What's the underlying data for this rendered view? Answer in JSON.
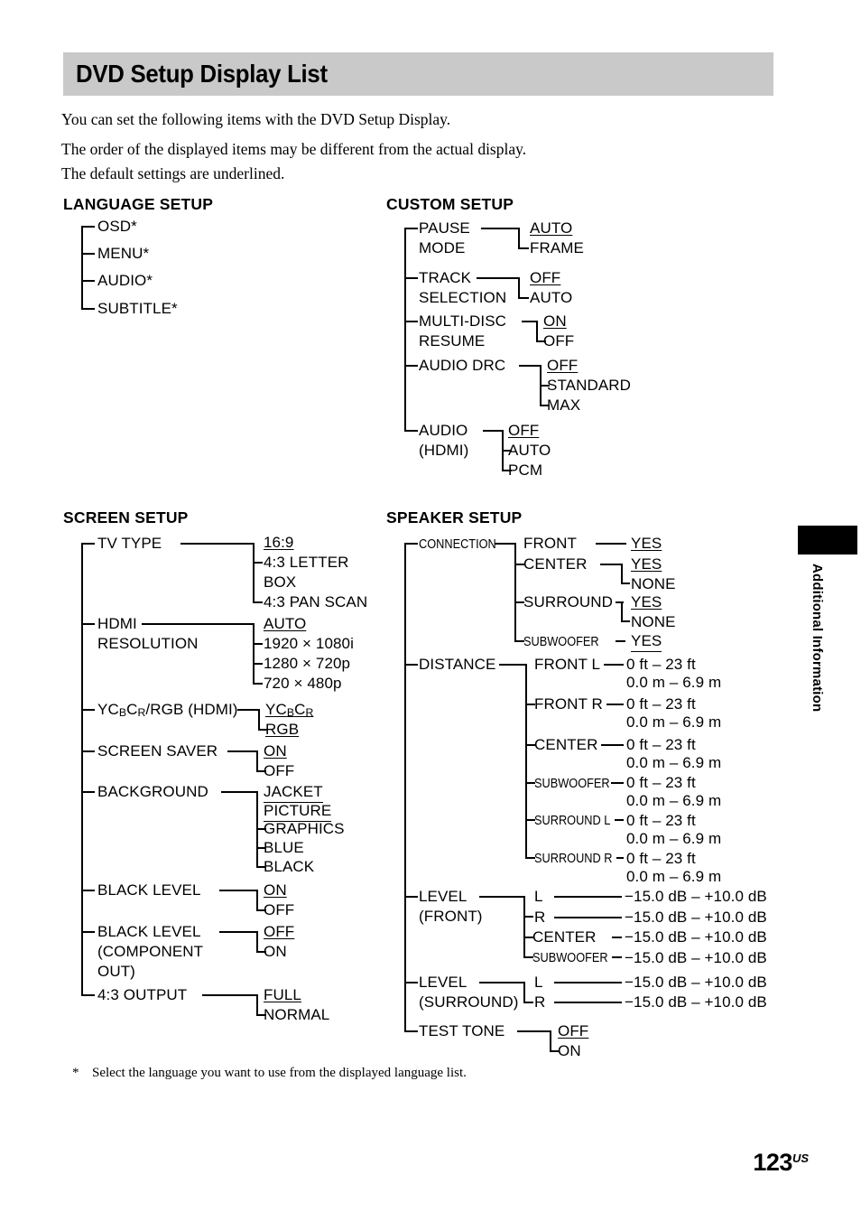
{
  "page": {
    "title": "DVD Setup Display List",
    "intro_line_1": "You can set the following items with the DVD Setup Display.",
    "intro_line_2a": "The order of the displayed items may be different from the actual display.",
    "intro_line_2b": "The default settings are underlined.",
    "footnote_marker": "*",
    "footnote_text": "Select the language you want to use from the displayed language list.",
    "page_number": "123",
    "page_number_suffix": "US",
    "side_tab_label": "Additional Information",
    "header_bg": "#c9c9c9"
  },
  "language_setup": {
    "title": "LANGUAGE SETUP",
    "items": [
      {
        "label": "OSD*"
      },
      {
        "label": "MENU*"
      },
      {
        "label": "AUDIO*"
      },
      {
        "label": "SUBTITLE*"
      }
    ]
  },
  "custom_setup": {
    "title": "CUSTOM SETUP",
    "items": [
      {
        "label_1": "PAUSE",
        "label_2": "MODE",
        "options": [
          "AUTO",
          "FRAME"
        ],
        "default": "AUTO"
      },
      {
        "label_1": "TRACK",
        "label_2": "SELECTION",
        "options": [
          "OFF",
          "AUTO"
        ],
        "default": "OFF"
      },
      {
        "label_1": "MULTI-DISC",
        "label_2": "RESUME",
        "options": [
          "ON",
          "OFF"
        ],
        "default": "ON"
      },
      {
        "label_1": "AUDIO DRC",
        "label_2": "",
        "options": [
          "OFF",
          "STANDARD",
          "MAX"
        ],
        "default": "OFF"
      },
      {
        "label_1": "AUDIO",
        "label_2": "(HDMI)",
        "options": [
          "OFF",
          "AUTO",
          "PCM"
        ],
        "default": "OFF"
      }
    ]
  },
  "screen_setup": {
    "title": "SCREEN SETUP",
    "items": [
      {
        "label_1": "TV TYPE",
        "options": [
          "16:9",
          "4:3 LETTER",
          "BOX",
          "4:3 PAN SCAN"
        ],
        "default": "16:9"
      },
      {
        "label_1": "HDMI",
        "label_2": "RESOLUTION",
        "options": [
          "AUTO",
          "1920 × 1080i",
          "1280 × 720p",
          "720 × 480p"
        ],
        "default": "AUTO"
      },
      {
        "label_1": "YCʙCʀ/RGB (HDMI)",
        "options": [
          "YCʙCʀ",
          "RGB"
        ],
        "default": "YCʙCʀ"
      },
      {
        "label_1": "SCREEN SAVER",
        "options": [
          "ON",
          "OFF"
        ],
        "default": "ON"
      },
      {
        "label_1": "BACKGROUND",
        "options": [
          "JACKET",
          "PICTURE",
          "GRAPHICS",
          "BLUE",
          "BLACK"
        ],
        "default": "JACKET PICTURE"
      },
      {
        "label_1": "BLACK LEVEL",
        "options": [
          "ON",
          "OFF"
        ],
        "default": "ON"
      },
      {
        "label_1": "BLACK LEVEL",
        "label_2": "(COMPONENT",
        "label_3": "OUT)",
        "options": [
          "OFF",
          "ON"
        ],
        "default": "OFF"
      },
      {
        "label_1": "4:3 OUTPUT",
        "options": [
          "FULL",
          "NORMAL"
        ],
        "default": "FULL"
      }
    ]
  },
  "speaker_setup": {
    "title": "SPEAKER SETUP",
    "connection": {
      "label": "CONNECTION",
      "rows": [
        {
          "name": "FRONT",
          "options": [
            "YES"
          ],
          "default": "YES"
        },
        {
          "name": "CENTER",
          "options": [
            "YES",
            "NONE"
          ],
          "default": "YES"
        },
        {
          "name": "SURROUND",
          "options": [
            "YES",
            "NONE"
          ],
          "default": "YES"
        },
        {
          "name": "SUBWOOFER",
          "options": [
            "YES"
          ],
          "default": "YES"
        }
      ]
    },
    "distance": {
      "label": "DISTANCE",
      "range_ft": "0 ft – 23 ft",
      "range_m": "0.0 m – 6.9 m",
      "rows": [
        "FRONT L",
        "FRONT R",
        "CENTER",
        "SUBWOOFER",
        "SURROUND L",
        "SURROUND R"
      ]
    },
    "level_front": {
      "label_1": "LEVEL",
      "label_2": "(FRONT)",
      "range": "−15.0 dB – +10.0 dB",
      "rows": [
        "L",
        "R",
        "CENTER",
        "SUBWOOFER"
      ]
    },
    "level_surround": {
      "label_1": "LEVEL",
      "label_2": "(SURROUND)",
      "range": "−15.0 dB – +10.0 dB",
      "rows": [
        "L",
        "R"
      ]
    },
    "test_tone": {
      "label": "TEST TONE",
      "options": [
        "OFF",
        "ON"
      ],
      "default": "OFF"
    }
  }
}
